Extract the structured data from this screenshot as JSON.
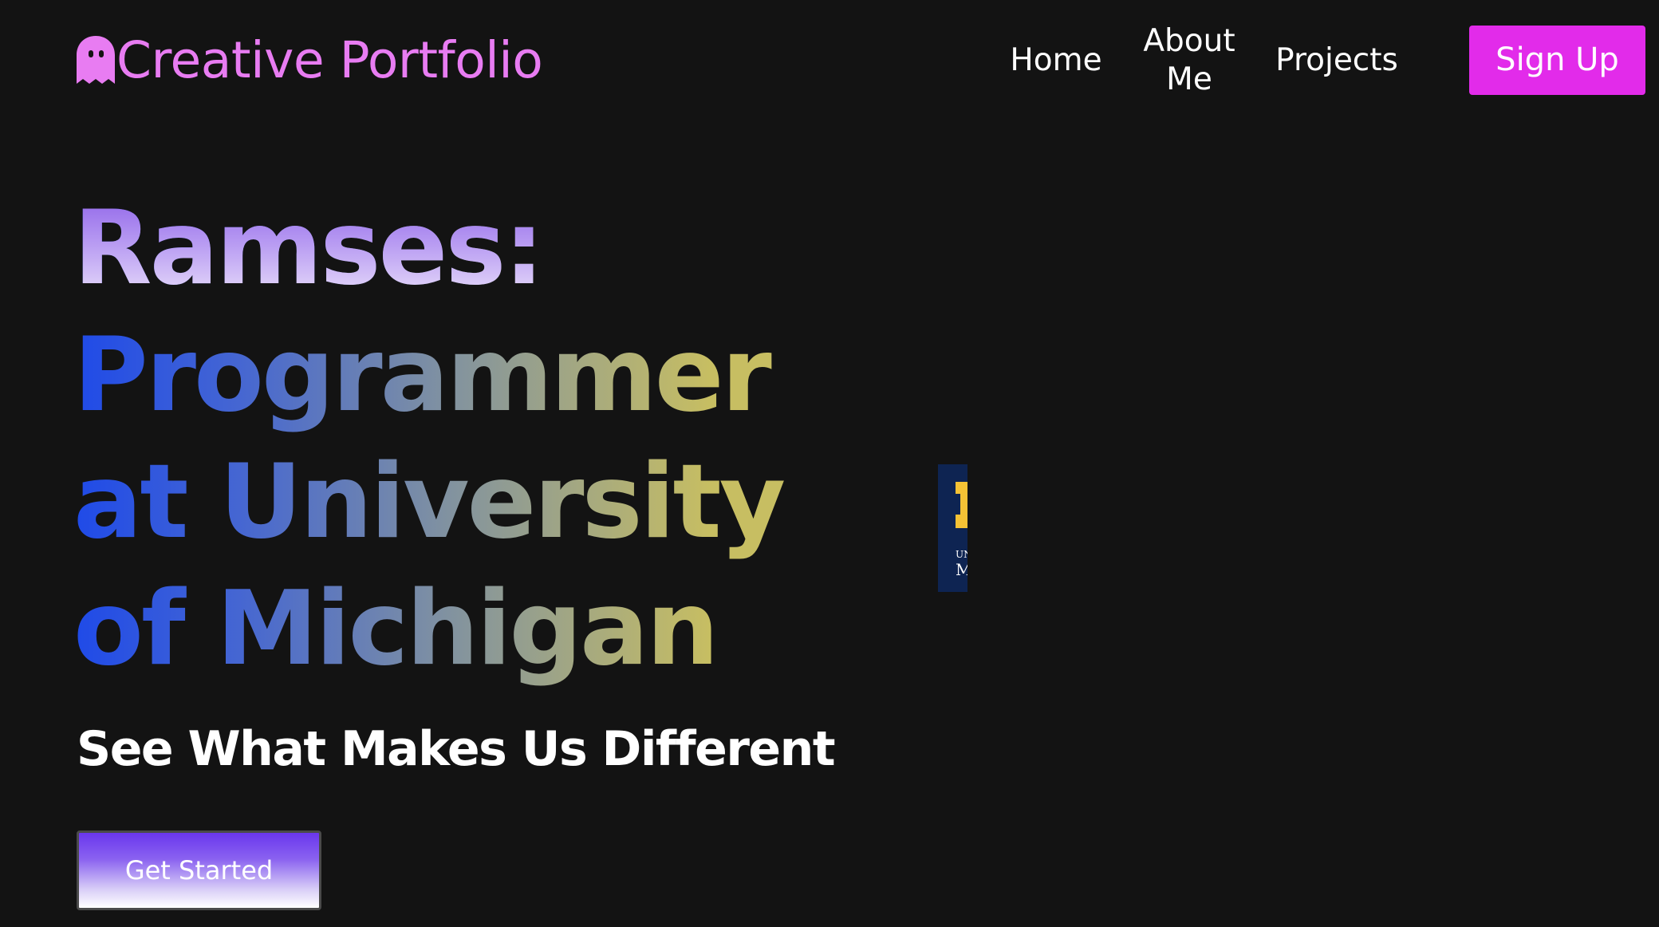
{
  "navbar": {
    "brand_text": "Creative Portfolio",
    "brand_icon": "ghost-icon",
    "links": [
      {
        "label": "Home"
      },
      {
        "label": "About Me"
      },
      {
        "label": "Projects"
      }
    ],
    "signup_label": "Sign Up"
  },
  "hero": {
    "name": "Ramses:",
    "tagline": "Programmer at University of Michigan",
    "subheading": "See What Makes Us Different",
    "cta_label": "Get Started",
    "logo_alt": "University of Michigan logo",
    "logo_letters": [
      "UN",
      "M"
    ]
  },
  "colors": {
    "background": "#131313",
    "brand": "#e87cf2",
    "signup": "#e22bea",
    "logo_navy": "#0e2452",
    "logo_maize": "#f5c235"
  }
}
